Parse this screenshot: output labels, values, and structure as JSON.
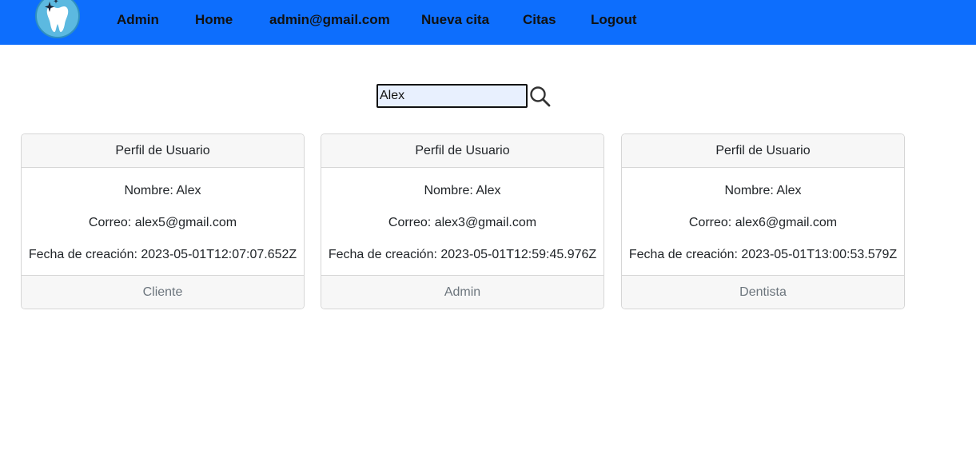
{
  "navbar": {
    "logo_icon": "tooth-sparkle-icon",
    "links": [
      "Admin",
      "Home",
      "admin@gmail.com",
      "Nueva cita",
      "Citas",
      "Logout"
    ]
  },
  "search": {
    "value": "Alex",
    "icon": "search-icon"
  },
  "cards": [
    {
      "header": "Perfil de Usuario",
      "name": "Nombre: Alex",
      "email": "Correo: alex5@gmail.com",
      "created": "Fecha de creación: 2023-05-01T12:07:07.652Z",
      "role": "Cliente"
    },
    {
      "header": "Perfil de Usuario",
      "name": "Nombre: Alex",
      "email": "Correo: alex3@gmail.com",
      "created": "Fecha de creación: 2023-05-01T12:59:45.976Z",
      "role": "Admin"
    },
    {
      "header": "Perfil de Usuario",
      "name": "Nombre: Alex",
      "email": "Correo: alex6@gmail.com",
      "created": "Fecha de creación: 2023-05-01T13:00:53.579Z",
      "role": "Dentista"
    }
  ],
  "colors": {
    "navbar_bg": "#0d6efd",
    "input_bg": "#e8f0fe",
    "card_header_bg": "#f7f7f7",
    "muted_text": "#6c757d"
  }
}
